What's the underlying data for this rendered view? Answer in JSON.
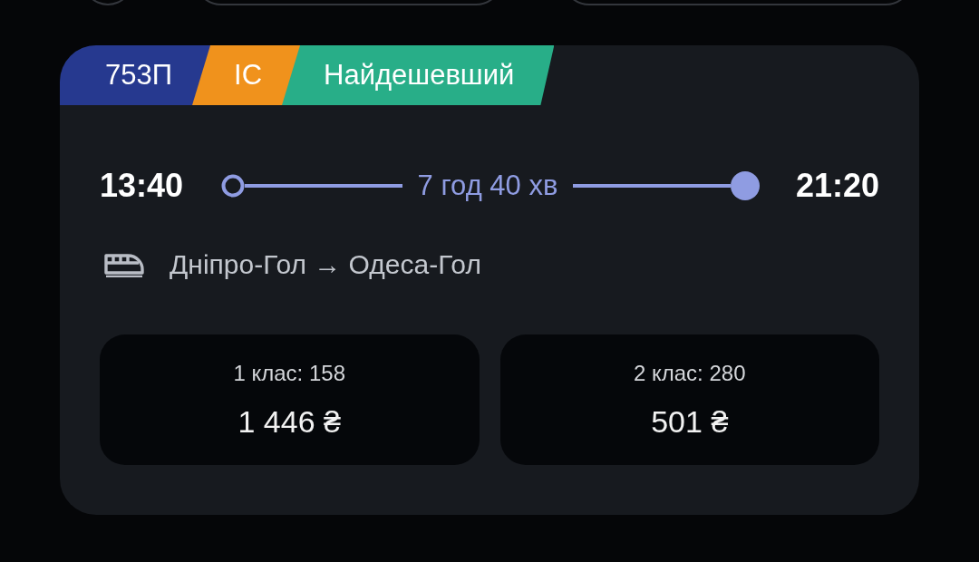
{
  "train": {
    "tags": [
      {
        "label": "753П",
        "color": "#26398f"
      },
      {
        "label": "IC",
        "color": "#f0921c"
      },
      {
        "label": "Найдешевший",
        "color": "#28ae88"
      }
    ],
    "departure_time": "13:40",
    "duration": "7 год 40 хв",
    "arrival_time": "21:20",
    "route": "Дніпро-Гол → Одеса-Гол",
    "fares": [
      {
        "class": "1 клас: 158",
        "price": "1 446 ₴"
      },
      {
        "class": "2 клас: 280",
        "price": "501 ₴"
      }
    ]
  }
}
